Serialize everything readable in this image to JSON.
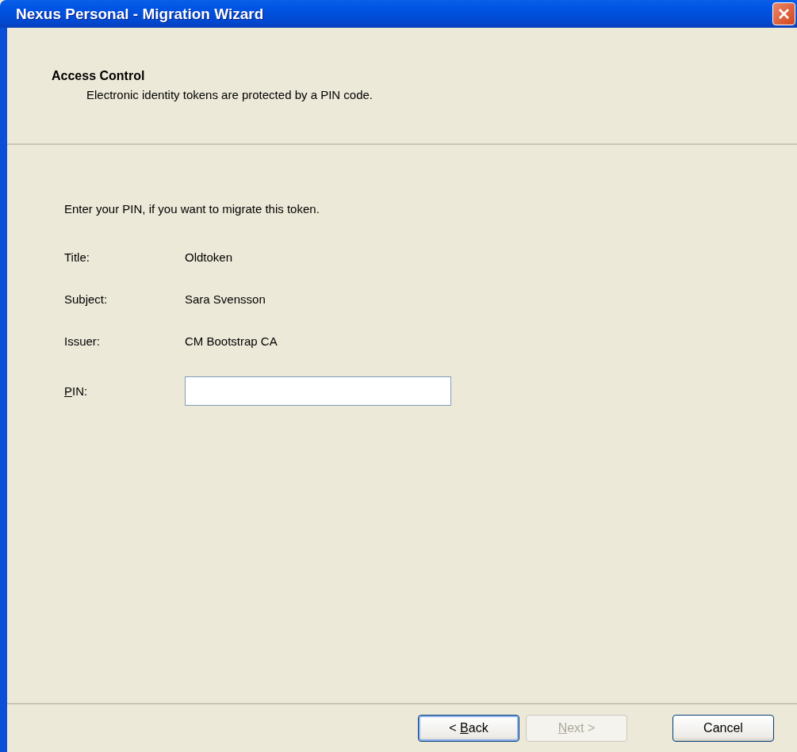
{
  "window": {
    "title": "Nexus Personal - Migration Wizard"
  },
  "header": {
    "title": "Access Control",
    "subtitle": "Electronic identity tokens are protected by a PIN code."
  },
  "instruction": "Enter your PIN, if you want to migrate this token.",
  "details": [
    {
      "label": "Title:",
      "value": "Oldtoken"
    },
    {
      "label": "Subject:",
      "value": "Sara Svensson"
    },
    {
      "label": "Issuer:",
      "value": "CM Bootstrap CA"
    }
  ],
  "pin_field": {
    "label": {
      "key": "P",
      "after": "IN:"
    }
  },
  "buttons": [
    {
      "label": {
        "before": "< ",
        "key": "B",
        "after": "ack"
      },
      "disabled": false,
      "default": true
    },
    {
      "label": {
        "key": "N",
        "after": "ext >"
      },
      "disabled": true,
      "default": false
    },
    {
      "label": {
        "after": "Cancel"
      },
      "disabled": false,
      "default": false
    }
  ]
}
